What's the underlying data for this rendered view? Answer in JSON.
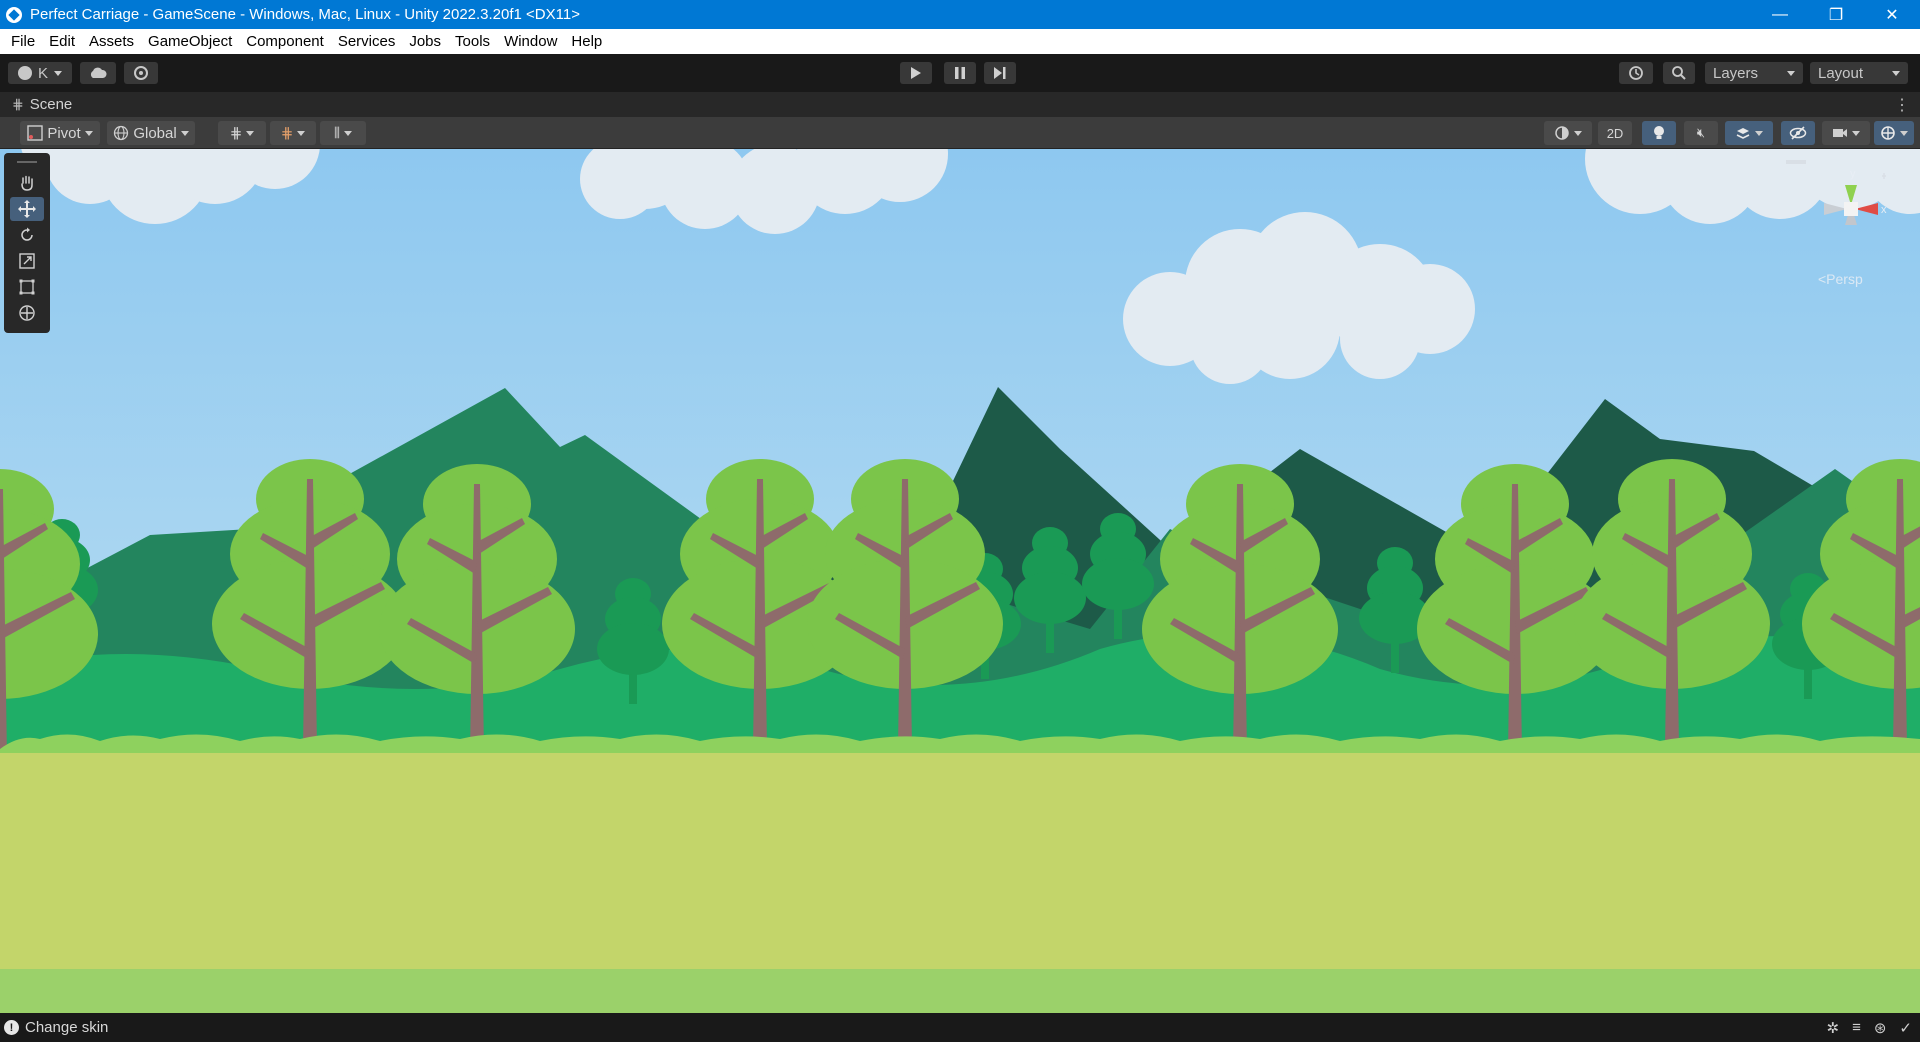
{
  "window": {
    "title": "Perfect Carriage - GameScene - Windows, Mac, Linux - Unity 2022.3.20f1 <DX11>",
    "controls": {
      "minimize": "—",
      "restore": "❐",
      "close": "✕"
    }
  },
  "menubar": {
    "items": [
      "File",
      "Edit",
      "Assets",
      "GameObject",
      "Component",
      "Services",
      "Jobs",
      "Tools",
      "Window",
      "Help"
    ]
  },
  "toolbar": {
    "account_label": "K",
    "account_icon": "account-icon",
    "cloud_icon": "cloud-icon",
    "collab_icon": "settings-cog-icon",
    "play_icon": "play-icon",
    "pause_icon": "pause-icon",
    "step_icon": "step-icon",
    "history_icon": "undo-history-icon",
    "search_icon": "search-icon",
    "layers_label": "Layers",
    "layout_label": "Layout"
  },
  "scene_tab": {
    "label": "Scene",
    "icon": "grid-icon"
  },
  "scene_toolbar": {
    "pivot_label": "Pivot",
    "global_label": "Global",
    "mode_2d_label": "2D"
  },
  "tool_palette": {
    "tools": [
      {
        "name": "hand-tool",
        "active": false
      },
      {
        "name": "move-tool",
        "active": true
      },
      {
        "name": "rotate-tool",
        "active": false
      },
      {
        "name": "scale-tool",
        "active": false
      },
      {
        "name": "rect-tool",
        "active": false
      },
      {
        "name": "transform-tool",
        "active": false
      }
    ]
  },
  "gizmo": {
    "y_label": "y",
    "x_label": "x",
    "projection_label": "<Persp"
  },
  "colors": {
    "titlebar": "#0078d4",
    "sky_top": "#8ec8f0",
    "sky_bottom": "#c6e4f2",
    "mountain_back": "#1d5a48",
    "mountain_front": "#23855e",
    "hills": "#1fae67",
    "tree_canopy": "#7bc54a",
    "tree_trunk": "#8e6b6b",
    "ground": "#c3d56a"
  },
  "statusbar": {
    "message": "Change skin"
  }
}
